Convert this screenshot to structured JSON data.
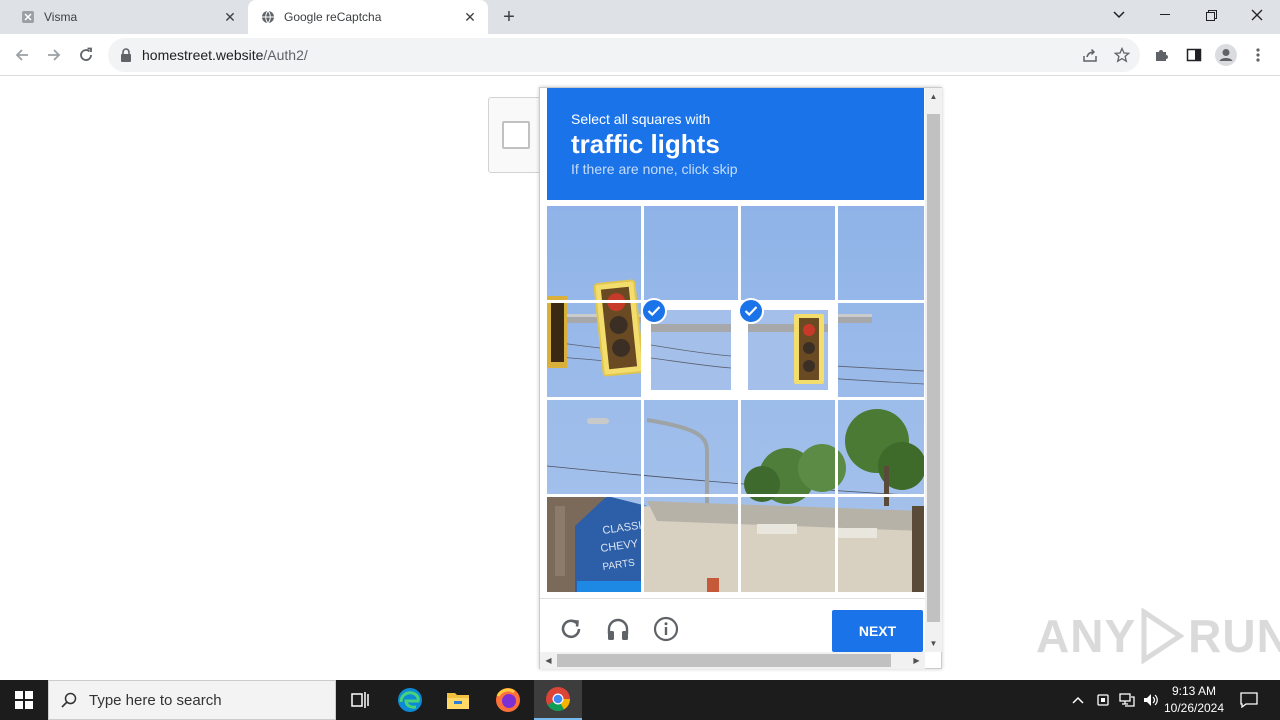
{
  "browser": {
    "tabs": [
      {
        "title": "Visma",
        "active": false
      },
      {
        "title": "Google reCaptcha",
        "active": true
      }
    ],
    "url_host": "homestreet.website",
    "url_path": "/Auth2/"
  },
  "captcha": {
    "instruction_line1": "Select all squares with",
    "target_object": "traffic lights",
    "instruction_line3": "If there are none, click skip",
    "grid_size": "4x4",
    "selected_tiles": [
      [
        1,
        1
      ],
      [
        1,
        2
      ]
    ],
    "next_label": "NEXT",
    "footer_icons": [
      "reload-icon",
      "audio-challenge-icon",
      "info-icon"
    ],
    "accent_color": "#1a73e8"
  },
  "watermark": {
    "text_left": "ANY",
    "text_right": "RUN"
  },
  "taskbar": {
    "search_placeholder": "Type here to search",
    "time": "9:13 AM",
    "date": "10/26/2024"
  }
}
